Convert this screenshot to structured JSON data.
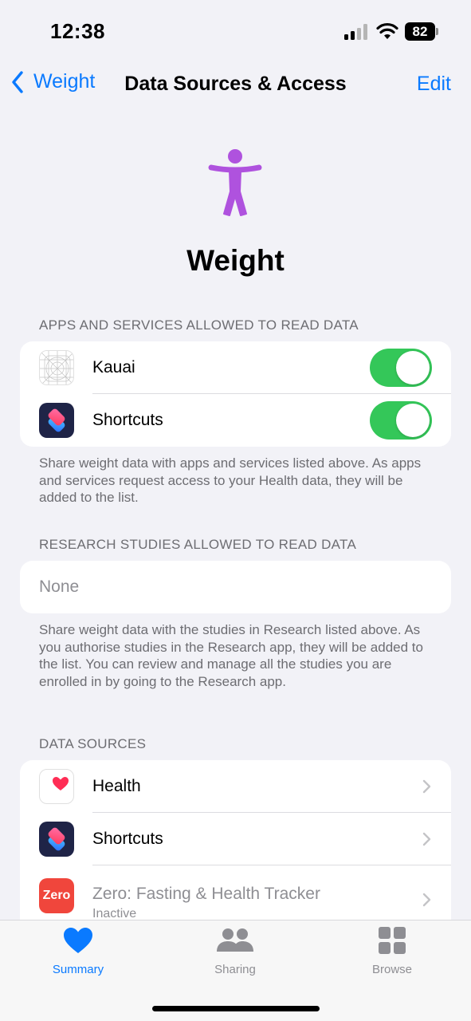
{
  "status_bar": {
    "time": "12:38",
    "battery_level": "82",
    "icons": [
      "cellular-signal-icon",
      "wifi-icon",
      "battery-icon"
    ]
  },
  "nav": {
    "back_label": "Weight",
    "title": "Data Sources & Access",
    "edit_label": "Edit"
  },
  "hero": {
    "icon": "body-figure-icon",
    "title": "Weight",
    "icon_color": "#af52de"
  },
  "read_access": {
    "header": "APPS AND SERVICES ALLOWED TO READ DATA",
    "apps": [
      {
        "name": "Kauai",
        "icon": "kauai-app-icon",
        "enabled": true
      },
      {
        "name": "Shortcuts",
        "icon": "shortcuts-app-icon",
        "enabled": true
      }
    ],
    "footer": "Share weight data with apps and services listed above. As apps and services request access to your Health data, they will be added to the list."
  },
  "research": {
    "header": "RESEARCH STUDIES ALLOWED TO READ DATA",
    "value": "None",
    "footer": "Share weight data with the studies in Research listed above. As you authorise studies in the Research app, they will be added to the list. You can review and manage all the studies you are enrolled in by going to the Research app."
  },
  "data_sources": {
    "header": "DATA SOURCES",
    "items": [
      {
        "name": "Health",
        "icon": "health-app-icon"
      },
      {
        "name": "Shortcuts",
        "icon": "shortcuts-app-icon"
      },
      {
        "name": "Zero: Fasting & Health Tracker",
        "status": "Inactive",
        "icon": "zero-app-icon",
        "icon_text": "Zero"
      }
    ]
  },
  "tabbar": {
    "tabs": [
      {
        "label": "Summary",
        "icon": "heart-icon",
        "active": true
      },
      {
        "label": "Sharing",
        "icon": "people-icon",
        "active": false
      },
      {
        "label": "Browse",
        "icon": "grid-icon",
        "active": false
      }
    ]
  },
  "colors": {
    "accent": "#0a7aff",
    "toggle_on": "#34c759",
    "background": "#f2f2f7",
    "zero_red": "#f0463c"
  }
}
